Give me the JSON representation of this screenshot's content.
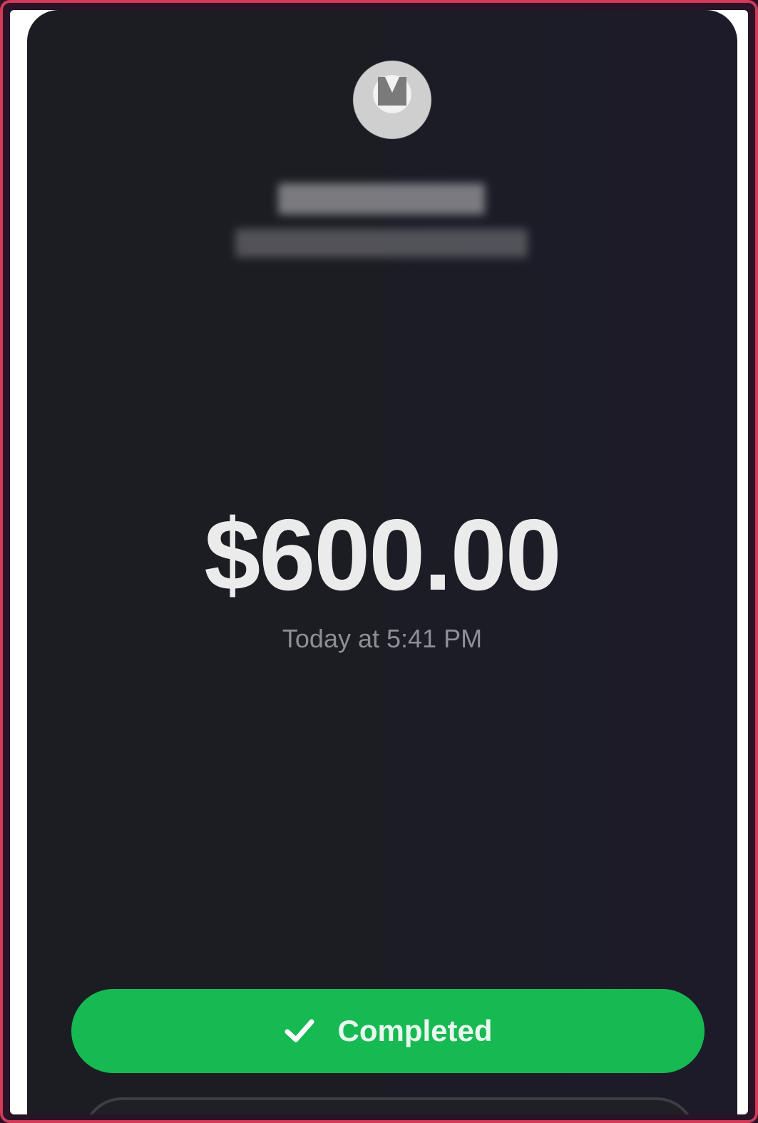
{
  "payment": {
    "amount": "$600.00",
    "timestamp": "Today at 5:41 PM"
  },
  "status_button": {
    "label": "Completed",
    "icon": "checkmark-icon"
  },
  "colors": {
    "background": "#1b1d22",
    "accent_green": "#17b953",
    "amount_text": "#ebebeb",
    "timestamp_text": "#8e8f95",
    "frame_border": "#d23a58"
  }
}
